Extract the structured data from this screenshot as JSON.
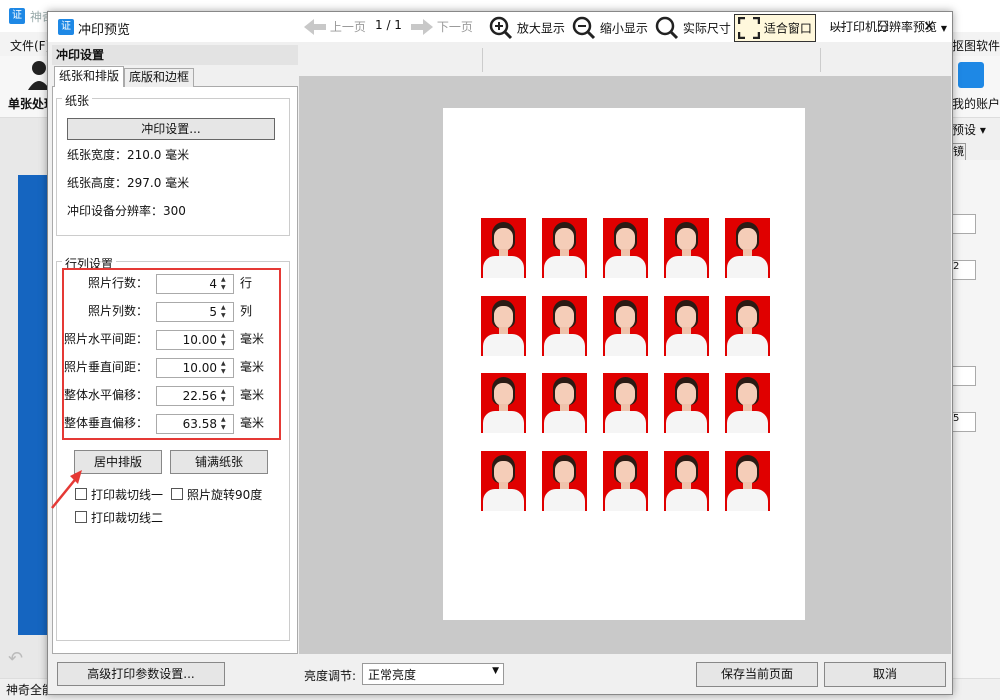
{
  "background_app": {
    "title": "神奇…",
    "menu_file": "文件(F)",
    "menu_right": "抠图软件",
    "toolbar_single": "单张处理",
    "account": "我的账户",
    "preset": "预设 ▾",
    "mirror": "镜",
    "status": "神奇全能",
    "right_values": [
      "",
      "2",
      "",
      "5"
    ]
  },
  "dialog": {
    "title": "冲印预览",
    "min_icon": "—",
    "max_icon": "☐",
    "close_icon": "✕",
    "settings_header": "冲印设置",
    "tabs": [
      "纸张和排版",
      "底版和边框"
    ],
    "paper": {
      "group_title": "纸张",
      "print_settings_button": "冲印设置...",
      "width": "纸张宽度：210.0 毫米",
      "height": "纸张高度：297.0 毫米",
      "resolution": "冲印设备分辨率：300"
    },
    "grid": {
      "group_title": "行列设置",
      "rows": [
        {
          "label": "照片行数：",
          "value": "4",
          "unit": "行"
        },
        {
          "label": "照片列数：",
          "value": "5",
          "unit": "列"
        },
        {
          "label": "照片水平间距：",
          "value": "10.00",
          "unit": "毫米"
        },
        {
          "label": "照片垂直间距：",
          "value": "10.00",
          "unit": "毫米"
        },
        {
          "label": "整体水平偏移：",
          "value": "22.56",
          "unit": "毫米"
        },
        {
          "label": "整体垂直偏移：",
          "value": "63.58",
          "unit": "毫米"
        }
      ],
      "center_button": "居中排版",
      "fill_button": "铺满纸张",
      "checkboxes": [
        "打印裁切线一",
        "照片旋转90度",
        "打印裁切线二"
      ]
    },
    "advanced_button": "高级打印参数设置...",
    "toolbar": {
      "prev": "上一页",
      "page": "1 / 1",
      "next": "下一页",
      "zoom_in": "放大显示",
      "zoom_out": "缩小显示",
      "actual": "实际尺寸",
      "fit": "适合窗口",
      "printer_preview": "以打印机分辨率预览"
    },
    "preview": {
      "photo_rows": 4,
      "photo_cols": 5
    },
    "brightness_label": "亮度调节:",
    "brightness_value": "正常亮度",
    "save_button": "保存当前页面",
    "cancel_button": "取消"
  },
  "colors": {
    "highlight": "#e53935",
    "photo_bg": "#e00000",
    "accent": "#1e88e5"
  }
}
